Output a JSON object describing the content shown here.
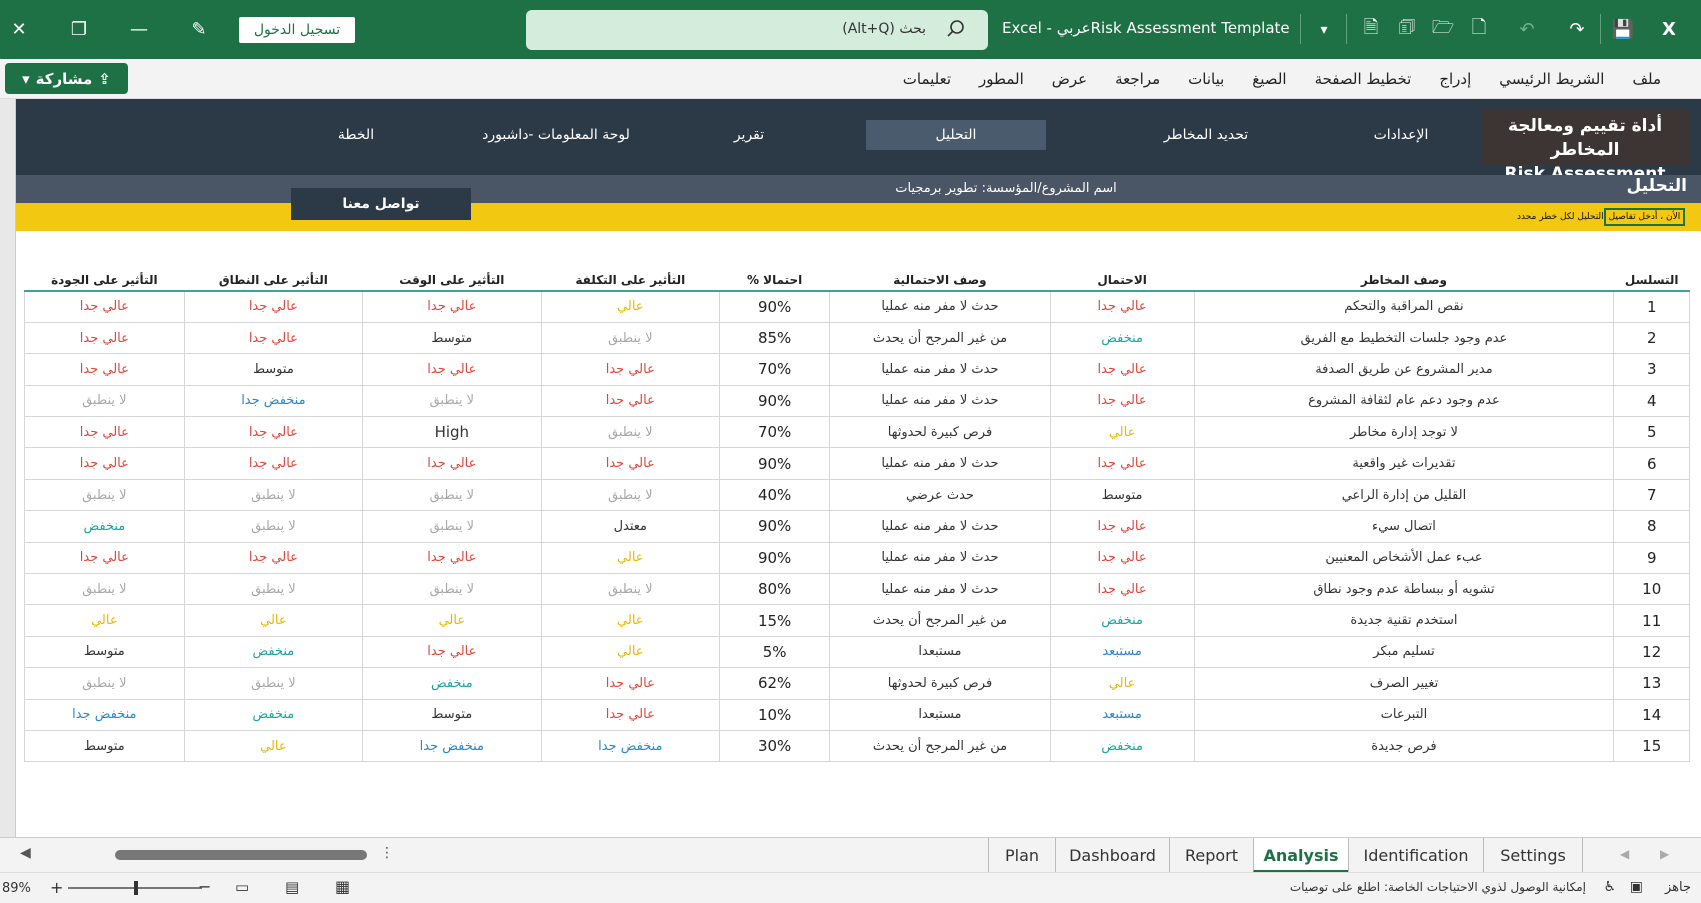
{
  "titlebar": {
    "login_label": "تسجيل الدخول",
    "search_placeholder": "بحث (Alt+Q)",
    "doc_title": "Excel  -  عربيRisk Assessment Template"
  },
  "ribbon": {
    "share_label": "مشاركة",
    "menu": [
      "ملف",
      "الشريط الرئيسي",
      "إدراج",
      "تخطيط الصفحة",
      "الصيغ",
      "بيانات",
      "مراجعة",
      "عرض",
      "المطور",
      "تعليمات"
    ]
  },
  "navbar": {
    "brand_ar": "أداة تقييم ومعالجة المخاطر",
    "brand_en": "Risk Assessment",
    "tabs": [
      "الإعدادات",
      "تحديد المخاطر",
      "التحليل",
      "تقرير",
      "لوحة المعلومات -داشبورد",
      "الخطة"
    ]
  },
  "subbar": {
    "title": "التحليل",
    "project_label": "اسم المشروع/المؤسسة:",
    "project_value": "تطوير برمجيات"
  },
  "yellowbar": {
    "hint_prefix": "الأن ، أدخل تفاصيل",
    "hint_rest": "التحليل لكل خطر محدد",
    "contact_label": "تواصل معنا"
  },
  "table": {
    "headers": [
      "التسلسل",
      "وصف المخاطر",
      "الاحتمال",
      "وصف الاحتمالية",
      "احتمالا %",
      "التأثير على التكلفة",
      "التأثير على الوقت",
      "التأثير على النطاق",
      "التأثير على الجودة"
    ],
    "rows": [
      [
        "1",
        "نقص المراقبة والتحكم",
        "عالي جدا",
        "حدث لا مفر منه عمليا",
        "90%",
        "عالي",
        "عالي جدا",
        "عالي جدا",
        "عالي جدا"
      ],
      [
        "2",
        "عدم وجود جلسات التخطيط مع الفريق",
        "منخفض",
        "من غير المرجح أن يحدث",
        "85%",
        "لا ينطبق",
        "متوسط",
        "عالي جدا",
        "عالي جدا"
      ],
      [
        "3",
        "مدير المشروع عن طريق الصدفة",
        "عالي جدا",
        "حدث لا مفر منه عمليا",
        "70%",
        "عالي جدا",
        "عالي جدا",
        "متوسط",
        "عالي جدا"
      ],
      [
        "4",
        "عدم وجود دعم عام لثقافة المشروع",
        "عالي جدا",
        "حدث لا مفر منه عمليا",
        "90%",
        "عالي جدا",
        "لا ينطبق",
        "منخفض جدا",
        "لا ينطبق"
      ],
      [
        "5",
        "لا توجد إدارة مخاطر",
        "عالي",
        "فرص كبيرة لحدوثها",
        "70%",
        "لا ينطبق",
        "High",
        "عالي جدا",
        "عالي جدا"
      ],
      [
        "6",
        "تقديرات غير واقعية",
        "عالي جدا",
        "حدث لا مفر منه عمليا",
        "90%",
        "عالي جدا",
        "عالي جدا",
        "عالي جدا",
        "عالي جدا"
      ],
      [
        "7",
        "القليل من إدارة الراعي",
        "متوسط",
        "حدث عرضي",
        "40%",
        "لا ينطبق",
        "لا ينطبق",
        "لا ينطبق",
        "لا ينطبق"
      ],
      [
        "8",
        "اتصال سيء",
        "عالي جدا",
        "حدث لا مفر منه عمليا",
        "90%",
        "معتدل",
        "لا ينطبق",
        "لا ينطبق",
        "منخفض"
      ],
      [
        "9",
        "عبء عمل الأشخاص المعنيين",
        "عالي جدا",
        "حدث لا مفر منه عمليا",
        "90%",
        "عالي",
        "عالي جدا",
        "عالي جدا",
        "عالي جدا"
      ],
      [
        "10",
        "تشويه أو ببساطة عدم وجود نطاق",
        "عالي جدا",
        "حدث لا مفر منه عمليا",
        "80%",
        "لا ينطبق",
        "لا ينطبق",
        "لا ينطبق",
        "لا ينطبق"
      ],
      [
        "11",
        "استخدم تقنية جديدة",
        "منخفض",
        "من غير المرجح أن يحدث",
        "15%",
        "عالي",
        "عالي",
        "عالي",
        "عالي"
      ],
      [
        "12",
        "تسليم مبكر",
        "مستبعد",
        "مستبعدا",
        "5%",
        "عالي",
        "عالي جدا",
        "منخفض",
        "متوسط"
      ],
      [
        "13",
        "تغيير الصرف",
        "عالي",
        "فرص كبيرة لحدوثها",
        "62%",
        "عالي جدا",
        "منخفض",
        "لا ينطبق",
        "لا ينطبق"
      ],
      [
        "14",
        "التبرعات",
        "مستبعد",
        "مستبعدا",
        "10%",
        "عالي جدا",
        "متوسط",
        "منخفض",
        "منخفض جدا"
      ],
      [
        "15",
        "فرص جديدة",
        "منخفض",
        "من غير المرجح أن يحدث",
        "30%",
        "منخفض جدا",
        "منخفض جدا",
        "عالي",
        "متوسط"
      ]
    ]
  },
  "sheet_tabs": [
    "Settings",
    "Identification",
    "Analysis",
    "Report",
    "Dashboard",
    "Plan"
  ],
  "active_sheet": "Analysis",
  "statusbar": {
    "zoom": "89%",
    "accessibility": "إمكانية الوصول لذوي الاحتياجات الخاصة: اطلع على توصيات",
    "ready": "جاهز"
  },
  "colors": {
    "excel_green": "#1e7145",
    "nav_dark": "#2c3a47",
    "yellow": "#f2c811",
    "very_high": "#e0473b",
    "high": "#e8b800",
    "low": "#1aa3a3",
    "very_low": "#2a86c9",
    "not_applicable": "#a8a8a8"
  }
}
